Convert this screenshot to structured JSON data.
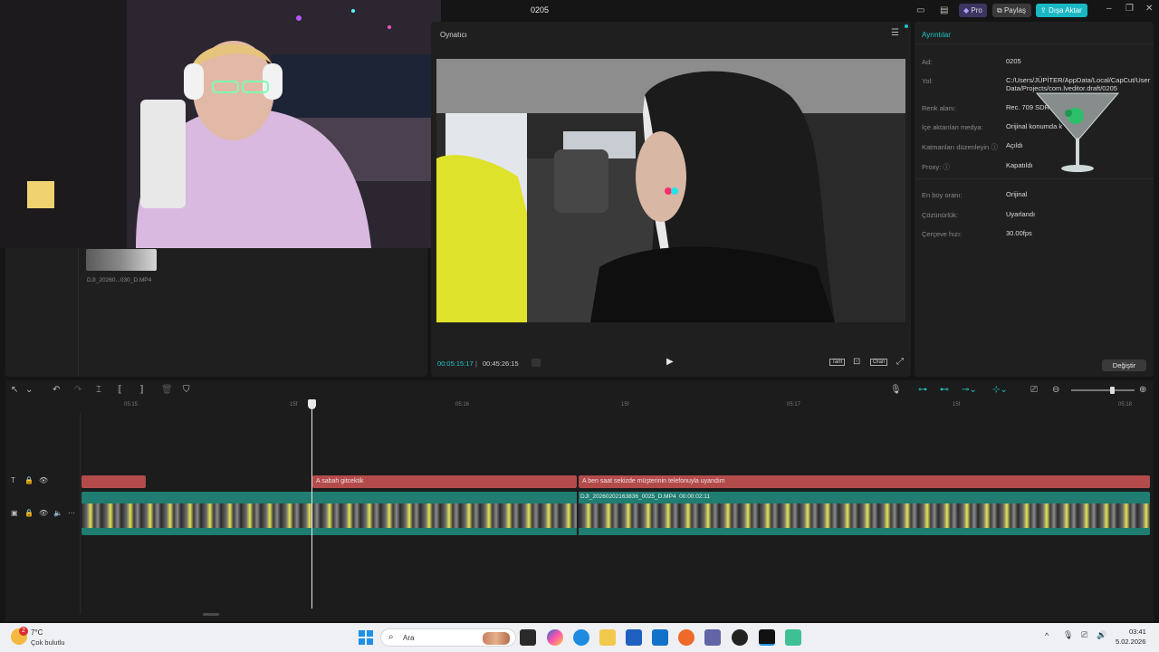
{
  "window": {
    "title": "0205",
    "pro_label": "Pro",
    "share_label": "Paylaş",
    "export_label": "Dışa Aktar"
  },
  "media": {
    "clip_name": "DJI_20260...030_D.MP4"
  },
  "player": {
    "title": "Oynatıcı",
    "current_time": "00:05:15:17",
    "total_time": "00:45:26:15",
    "full_label": "Tam",
    "ratio_label": "Oran"
  },
  "details": {
    "title": "Ayrıntılar",
    "rows": [
      {
        "label": "Ad:",
        "value": "0205"
      },
      {
        "label": "Yol:",
        "value": "C:/Users/JÜPİTER/AppData/Local/CapCut/User Data/Projects/com.lveditor.draft/0205"
      },
      {
        "label": "Renk alanı:",
        "value": "Rec. 709 SDR"
      },
      {
        "label": "İçe aktarılan medya:",
        "value": "Orijinal konumda k"
      },
      {
        "label": "Katmanları düzenleyin",
        "value": "Açıldı"
      },
      {
        "label": "Proxy:",
        "value": "Kapatıldı"
      },
      {
        "label": "En boy oranı:",
        "value": "Orijinal"
      },
      {
        "label": "Çözünürlük:",
        "value": "Uyarlandı"
      },
      {
        "label": "Çerçeve hızı:",
        "value": "30.00fps"
      }
    ],
    "change_button": "Değiştir"
  },
  "timeline": {
    "ruler": [
      "05:15",
      "15f",
      "05:16",
      "15f",
      "05:17",
      "15f",
      "05:18"
    ],
    "text_clip_1": "sabah gitcektik",
    "text_clip_2": "ben saat sekizde müşterinin telefonuyla uyandım",
    "video_clip_name": "DJI_20260202163836_0025_D.MP4",
    "video_clip_duration": "00:00:02:11"
  },
  "taskbar": {
    "weather_temp": "7°C",
    "weather_desc": "Çok bulutlu",
    "weather_badge": "2",
    "search_label": "Ara",
    "time": "03:41",
    "date": "5.02.2026"
  },
  "colors": {
    "accent": "#21c5c8",
    "text_clip": "#b34b4b",
    "video_track": "#1f7d72",
    "export_btn": "#19b8c4"
  }
}
